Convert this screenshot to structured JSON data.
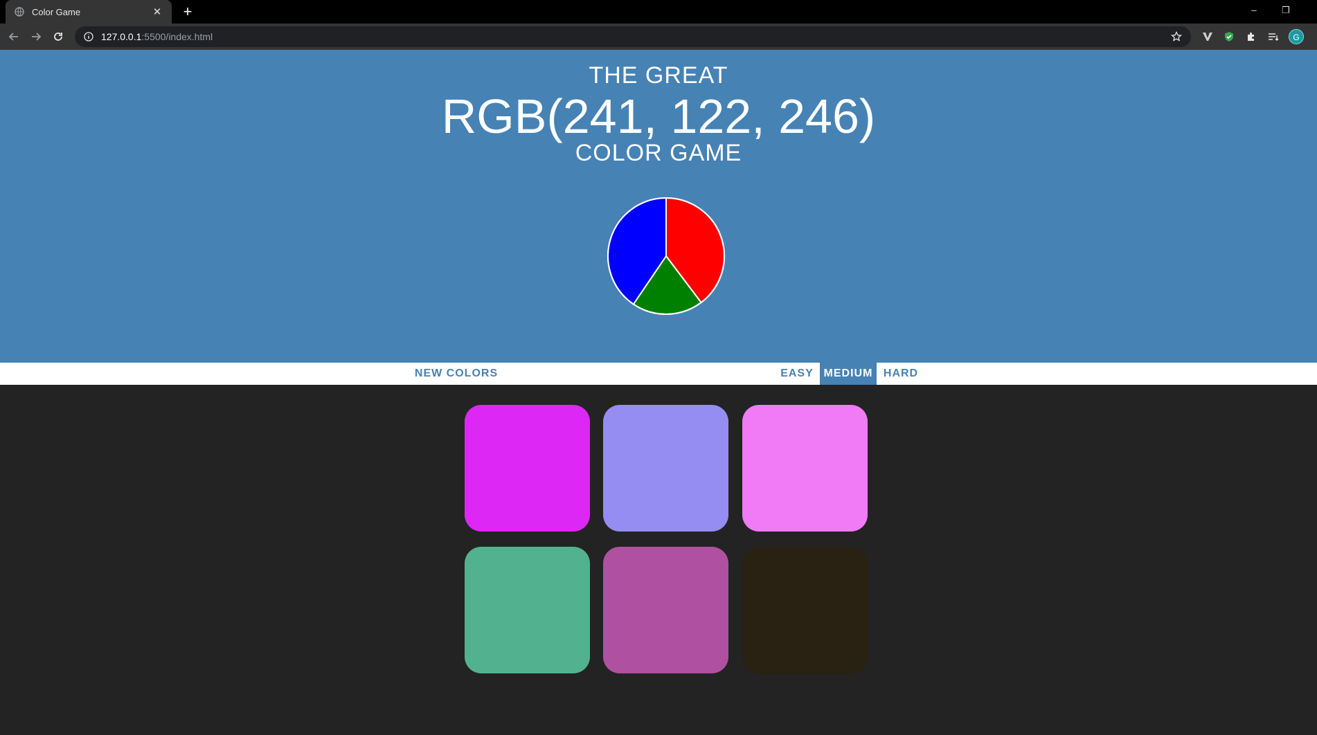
{
  "browser": {
    "tab_title": "Color Game",
    "tab_close": "✕",
    "new_tab": "+",
    "url_host": "127.0.0.1",
    "url_path": ":5500/index.html",
    "window_minimize": "–",
    "window_restore": "❐",
    "profile_initial": "G"
  },
  "header": {
    "line1": "THE GREAT",
    "color_display": "RGB(241, 122, 246)",
    "line3": "COLOR GAME",
    "background": "#4682b4"
  },
  "stripe": {
    "new_colors": "NEW COLORS",
    "easy": "EASY",
    "medium": "MEDIUM",
    "hard": "HARD",
    "selected_mode": "MEDIUM"
  },
  "squares": [
    {
      "color": "#dd27f4"
    },
    {
      "color": "#958df2"
    },
    {
      "color": "#f17af6"
    },
    {
      "color": "#52b290"
    },
    {
      "color": "#af51a0"
    },
    {
      "color": "#292111"
    }
  ],
  "colors": {
    "page_background": "#232323",
    "accent": "#4682b4",
    "wheel_red": "#ff0000",
    "wheel_green": "#008000",
    "wheel_blue": "#0000ff"
  }
}
